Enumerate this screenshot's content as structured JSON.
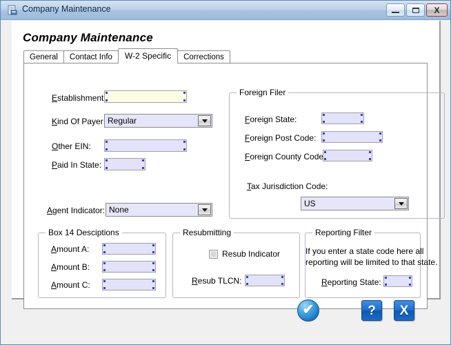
{
  "window": {
    "title": "Company Maintenance",
    "icon": "document-icon",
    "controls": {
      "minimize": "–",
      "maximize": "□",
      "close": "X"
    }
  },
  "page": {
    "heading": "Company Maintenance"
  },
  "tabs": [
    {
      "label": "General",
      "active": false
    },
    {
      "label": "Contact Info",
      "active": false
    },
    {
      "label": "W-2 Specific",
      "active": true
    },
    {
      "label": "Corrections",
      "active": false
    }
  ],
  "left_form": {
    "establishment": {
      "label": "Establishment:",
      "accel": "E",
      "value": "",
      "highlighted": true
    },
    "kind_of_payer": {
      "label": "Kind Of Payer:",
      "accel": "K",
      "value": "Regular",
      "options": [
        "Regular"
      ]
    },
    "other_ein": {
      "label": "Other EIN:",
      "accel": "O",
      "value": ""
    },
    "paid_in_state": {
      "label": "Paid In State:",
      "accel": "P",
      "value": ""
    },
    "agent_indicator": {
      "label": "Agent Indicator:",
      "accel": "A",
      "value": "None",
      "options": [
        "None"
      ]
    }
  },
  "foreign_filer": {
    "caption": "Foreign Filer",
    "foreign_state": {
      "label": "Foreign State:",
      "accel": "F",
      "value": ""
    },
    "foreign_post_code": {
      "label": "Foreign Post Code:",
      "accel": "F",
      "value": ""
    },
    "foreign_county_code": {
      "label": "Foreign County Code:",
      "accel": "F",
      "value": ""
    },
    "tax_jurisdiction_code": {
      "label": "Tax Jurisdiction Code:",
      "accel": "T",
      "value": "US",
      "options": [
        "US"
      ]
    }
  },
  "box14": {
    "caption": "Box 14 Desciptions",
    "amount_a": {
      "label": "Amount A:",
      "accel": "A",
      "value": ""
    },
    "amount_b": {
      "label": "Amount B:",
      "accel": "A",
      "value": ""
    },
    "amount_c": {
      "label": "Amount C:",
      "accel": "A",
      "value": ""
    }
  },
  "resubmitting": {
    "caption": "Resubmitting",
    "resub_indicator": {
      "label": "Resub Indicator",
      "checked": false,
      "disabled": true
    },
    "resub_tlcn": {
      "label": "Resub TLCN:",
      "accel": "R",
      "value": ""
    }
  },
  "reporting_filter": {
    "caption": "Reporting Filter",
    "note_line1": "If you enter a state code here all",
    "note_line2": "reporting will be limited to that state.",
    "reporting_state": {
      "label": "Reporting State:",
      "accel": "R",
      "value": ""
    }
  },
  "actions": {
    "ok": {
      "name": "ok-button",
      "glyph": "✔"
    },
    "help": {
      "name": "help-button",
      "glyph": "?"
    },
    "close": {
      "name": "close-button",
      "glyph": "X"
    }
  },
  "colors": {
    "titlebar": "#a8c3e0",
    "field_fill": "#e2e2fa",
    "field_highlight": "#fdfde3",
    "accent_blue": "#1f6ecb",
    "window_bg": "#f0f0f0"
  }
}
